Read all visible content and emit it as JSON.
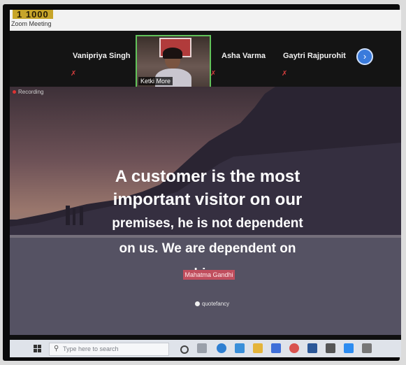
{
  "app": {
    "logo": "1 1000",
    "window_title": "Zoom Meeting"
  },
  "participants": [
    {
      "name": "Vanipriya Singh",
      "muted": true
    },
    {
      "name": "Ketki More",
      "video": true
    },
    {
      "name": "Asha Varma",
      "muted": true
    },
    {
      "name": "Gaytri Rajpurohit",
      "muted": true
    }
  ],
  "icons": {
    "muted": "microphone-muted-icon",
    "next_page": "chevron-right-icon",
    "start": "windows-start-icon",
    "search": "search-icon"
  },
  "glyphs": {
    "muted": "✗",
    "next_page": "›",
    "search": "⚲"
  },
  "share": {
    "recording_label": "Recording",
    "quote_lines": [
      "A customer is the most",
      "important visitor on our",
      "premises, he is not dependent",
      "on us. We are dependent on him."
    ],
    "author": "Mahatma Gandhi",
    "brand": "quotefancy"
  },
  "taskbar": {
    "search_placeholder": "Type here to search"
  },
  "colors": {
    "active_speaker_border": "#62c35a",
    "author_badge": "#c04e5e",
    "muted_icon": "#d53d3d",
    "nav_button": "#3a7bdc"
  }
}
